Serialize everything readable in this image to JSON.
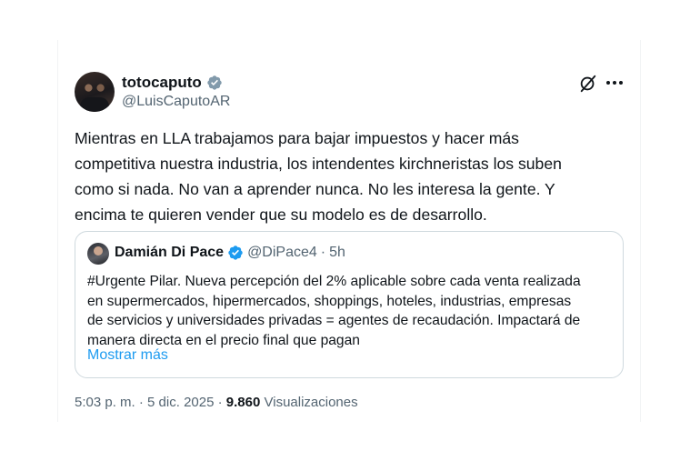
{
  "author": {
    "display_name": "totocaputo",
    "handle": "@LuisCaputoAR",
    "verified_badge": "grey-verified-icon",
    "verified_color": "#829aab"
  },
  "tweet": {
    "text": "Mientras en LLA trabajamos para  bajar impuestos y hacer más\ncompetitiva nuestra industria, los intendentes kirchneristas los suben\ncomo si nada. No van a aprender nunca. No les interesa la gente. Y\nencima te quieren vender que su modelo es de desarrollo."
  },
  "quoted": {
    "display_name": "Damián Di Pace",
    "handle": "@DiPace4",
    "separator": "·",
    "time": "5h",
    "verified_badge": "blue-verified-icon",
    "verified_color": "#1d9bf0",
    "text": "#Urgente Pilar. Nueva percepción del 2% aplicable sobre cada venta realizada\nen supermercados, hipermercados, shoppings, hoteles, industrias, empresas\nde servicios y universidades privadas = agentes de recaudación. Impactará de\nmanera directa en el precio final que pagan",
    "show_more": "Mostrar más"
  },
  "meta": {
    "time": "5:03 p. m.",
    "sep1": "·",
    "date": "5 dic. 2025",
    "sep2": "·",
    "views_count": "9.860",
    "views_label": "Visualizaciones"
  },
  "icons": {
    "grok": "grok-icon",
    "more": "more-options-icon"
  }
}
